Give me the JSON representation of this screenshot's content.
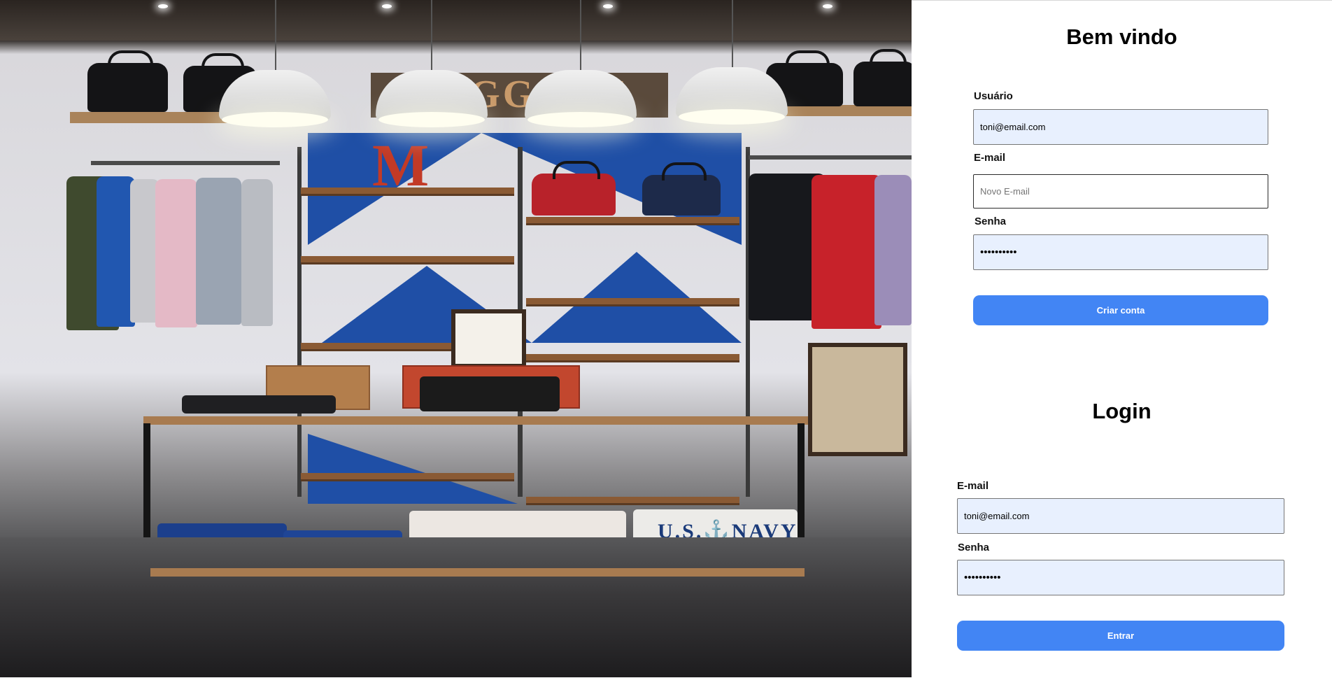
{
  "hero_image": {
    "alt_icon": "clothing-store-photo"
  },
  "signup": {
    "title": "Bem vindo",
    "username_label": "Usuário",
    "username_value": "toni@email.com",
    "email_label": "E-mail",
    "email_placeholder": "Novo E-mail",
    "password_label": "Senha",
    "password_value": "••••••••••",
    "submit_label": "Criar conta"
  },
  "login": {
    "title": "Login",
    "email_label": "E-mail",
    "email_value": "toni@email.com",
    "password_label": "Senha",
    "password_value": "••••••••••",
    "submit_label": "Entrar"
  },
  "colors": {
    "button": "#4285f4",
    "autofill": "#e8f0fe"
  },
  "photo_text": {
    "sign": "BAGGAGE",
    "letter": "M",
    "shirt_print": "U.S.⚓NAVY"
  }
}
